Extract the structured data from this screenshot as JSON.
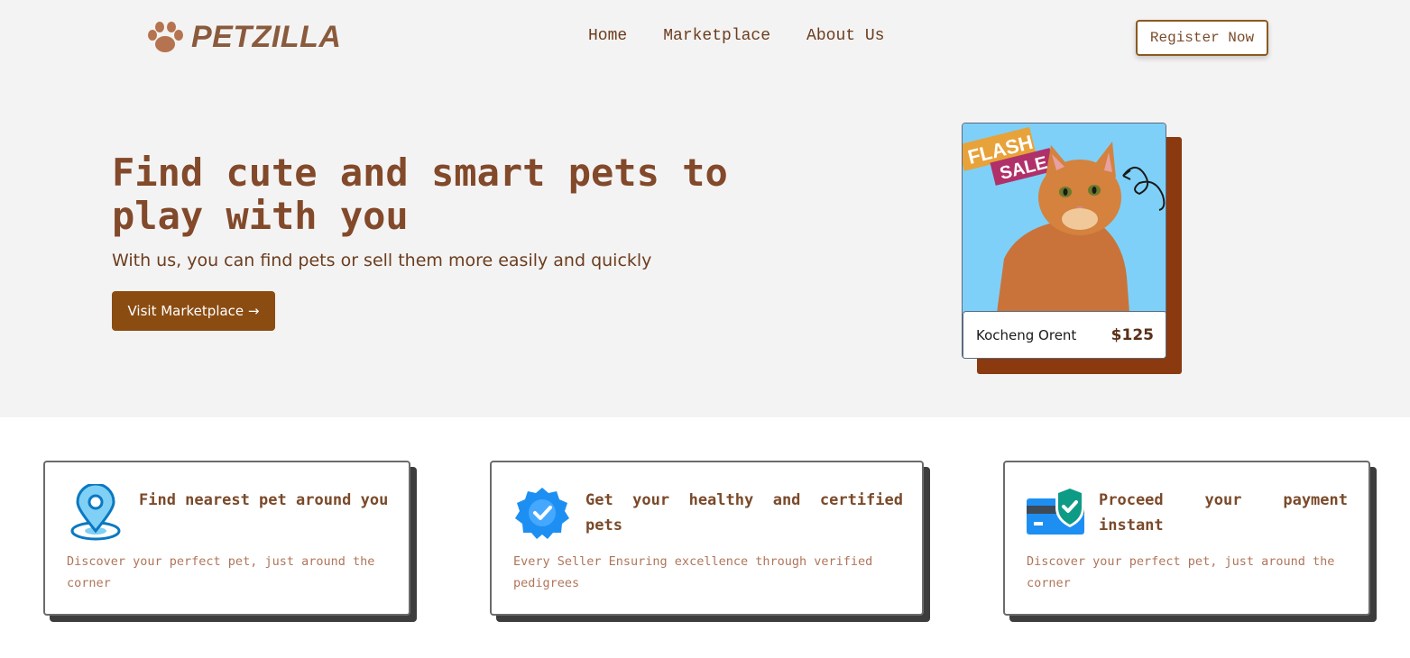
{
  "brand": {
    "name": "PETZILLA",
    "logo_icon": "paw-icon"
  },
  "nav": {
    "items": [
      {
        "label": "Home"
      },
      {
        "label": "Marketplace"
      },
      {
        "label": "About Us"
      }
    ],
    "register_label": "Register Now"
  },
  "hero": {
    "title": "Find cute and smart pets to play with you",
    "subtitle": "With us, you can find pets or sell them more easily and quickly",
    "cta_label": "Visit Marketplace →"
  },
  "product": {
    "badge_line1": "FLASH",
    "badge_line2": "SALE",
    "name": "Kocheng Orent",
    "price": "$125"
  },
  "features": [
    {
      "icon": "location-pin-icon",
      "title": "Find nearest pet around you",
      "desc": "Discover your perfect pet, just around the corner"
    },
    {
      "icon": "verified-badge-icon",
      "title": "Get your healthy and certified pets",
      "desc": "Every Seller Ensuring excellence through verified pedigrees"
    },
    {
      "icon": "secure-payment-icon",
      "title": "Proceed your payment instant",
      "desc": "Discover your perfect pet, just around the corner"
    }
  ],
  "colors": {
    "brand_brown": "#8b4c12",
    "card_shadow": "#8b3a10",
    "hero_bg": "#f4f3f3",
    "card_sky": "#7ed0f8"
  }
}
